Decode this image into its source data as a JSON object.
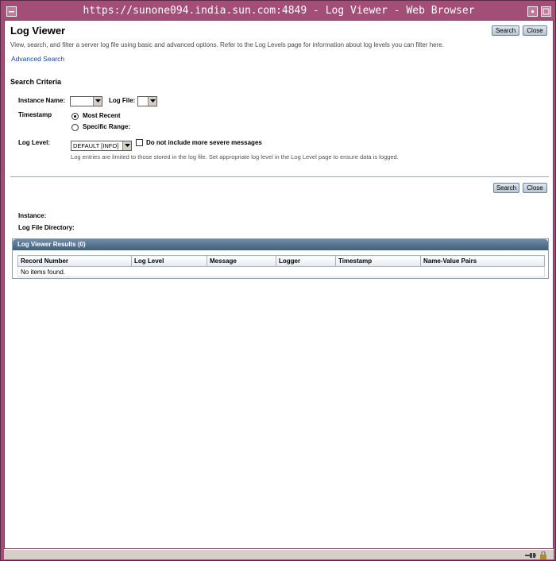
{
  "window": {
    "title": "https://sunone094.india.sun.com:4849 - Log Viewer - Web Browser"
  },
  "header": {
    "page_title": "Log Viewer",
    "help_text": "View, search, and filter a server log file using basic and advanced options. Refer to the Log Levels page for information about log levels you can filter here.",
    "advanced_search": "Advanced Search",
    "search_button": "Search",
    "close_button": "Close"
  },
  "search_criteria": {
    "title": "Search Criteria",
    "instance_name_label": "Instance Name:",
    "instance_name_value": "",
    "log_file_label": "Log File:",
    "log_file_value": "",
    "timestamp_label": "Timestamp",
    "timestamp_options": [
      "Most Recent",
      "Specific Range:"
    ],
    "timestamp_selected": "Most Recent",
    "log_level_label": "Log Level:",
    "log_level_value": "DEFAULT [INFO]",
    "exclude_severe_label": "Do not include more severe messages",
    "exclude_severe_checked": false,
    "note": "Log entries are limited to those stored in the log file. Set appropriate log level in the Log Level page to ensure data is logged."
  },
  "footer_buttons": {
    "search_button": "Search",
    "close_button": "Close"
  },
  "info": {
    "instance_label": "Instance:",
    "log_file_directory_label": "Log File Directory:"
  },
  "results": {
    "title": "Log Viewer Results (0)",
    "columns": [
      "Record Number",
      "Log Level",
      "Message",
      "Logger",
      "Timestamp",
      "Name-Value Pairs"
    ],
    "empty_message": "No items found."
  },
  "colors": {
    "frame": "#a24e76",
    "link": "#0d4aa0",
    "table_header": "#3f607e"
  }
}
